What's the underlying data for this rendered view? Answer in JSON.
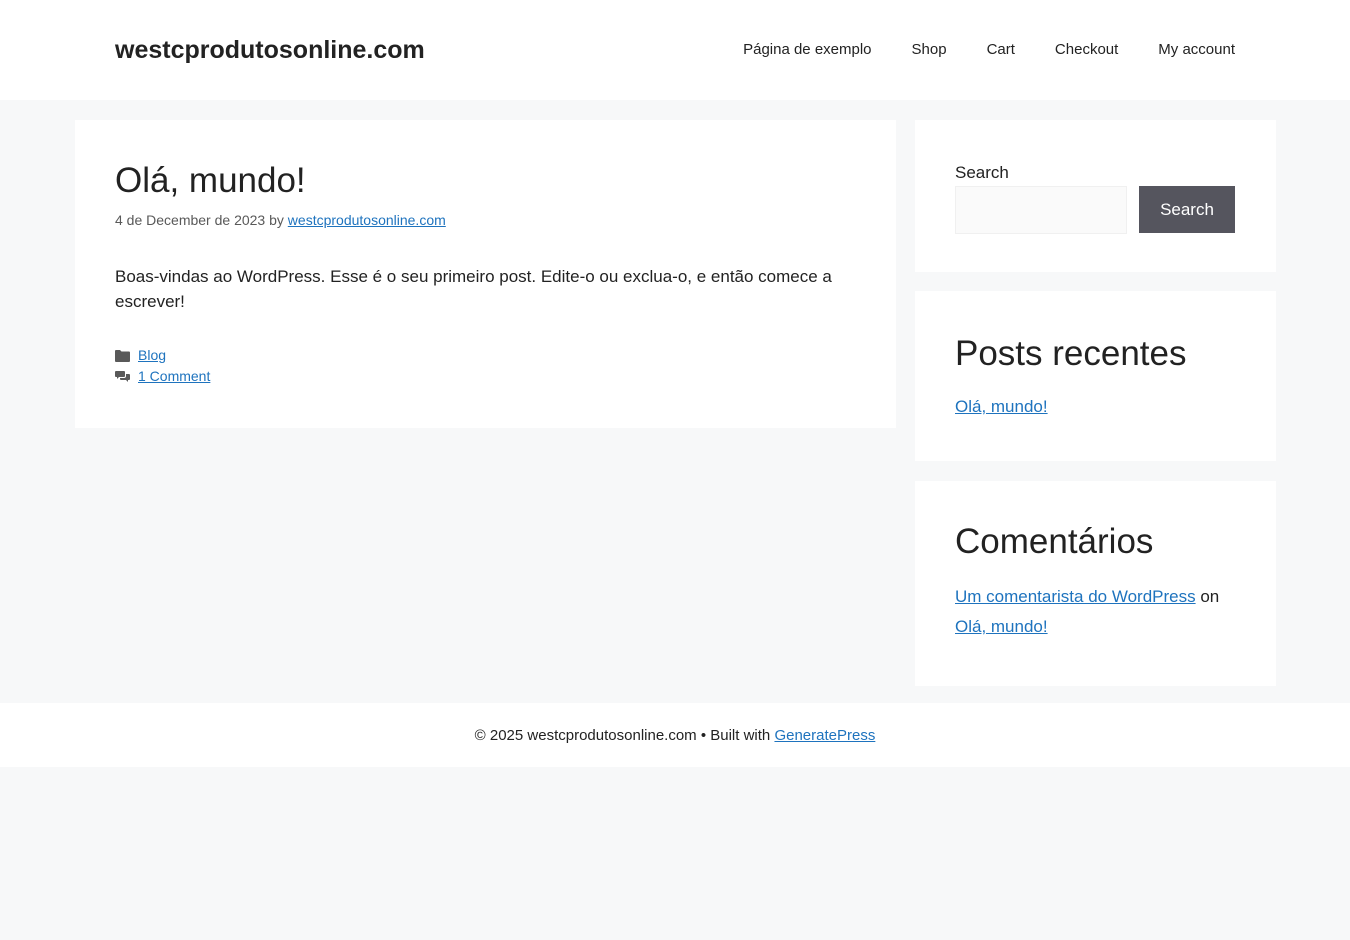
{
  "header": {
    "site_title": "westcprodutosonline.com",
    "nav": [
      {
        "label": "Página de exemplo"
      },
      {
        "label": "Shop"
      },
      {
        "label": "Cart"
      },
      {
        "label": "Checkout"
      },
      {
        "label": "My account"
      }
    ]
  },
  "article": {
    "title": "Olá, mundo!",
    "meta_date": "4 de December de 2023",
    "meta_by": "by",
    "meta_author": "westcprodutosonline.com",
    "content": "Boas-vindas ao WordPress. Esse é o seu primeiro post. Edite-o ou exclua-o, e então comece a escrever!",
    "category_link": "Blog",
    "comments_link": "1 Comment"
  },
  "sidebar": {
    "search_label": "Search",
    "search_value": "",
    "search_button": "Search",
    "recent_title": "Posts recentes",
    "recent_posts": [
      "Olá, mundo!"
    ],
    "comments_title": "Comentários",
    "comment_author": "Um comentarista do WordPress",
    "comment_on": "on",
    "comment_post": "Olá, mundo!"
  },
  "footer": {
    "copyright": "© 2025 westcprodutosonline.com • Built with",
    "link": "GeneratePress"
  },
  "colors": {
    "page_bg": "#f7f8f9",
    "link": "#1e73be",
    "button_bg": "#55555e"
  }
}
